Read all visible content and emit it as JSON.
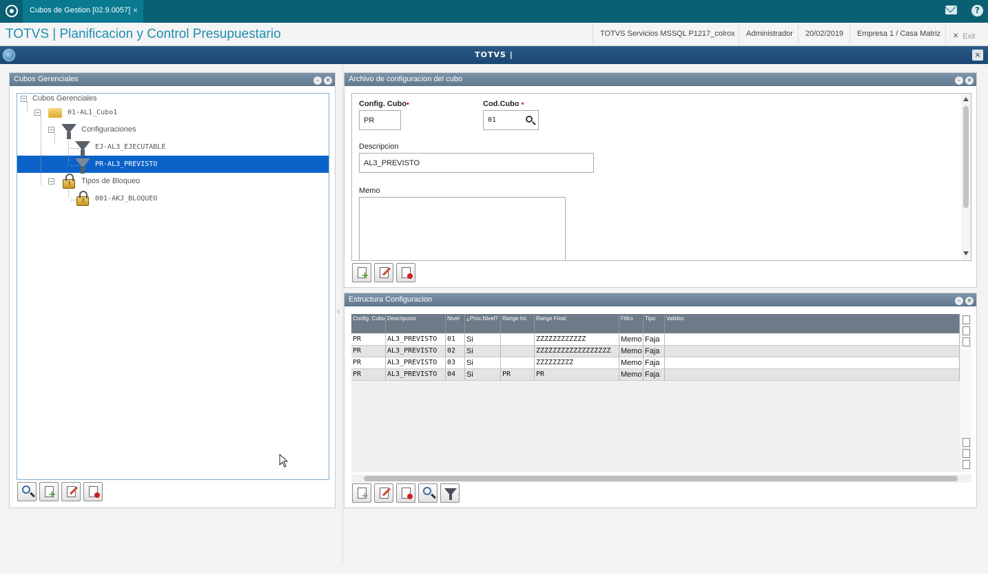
{
  "topbar": {
    "tab_label": "Cubos de Gestion [02.9.0057]",
    "tab_close": "×",
    "help": "?"
  },
  "titlebar": {
    "app_title": "TOTVS | Planificacion y Control Presupuestario",
    "server": "TOTVS Servicios MSSQL P1217_colrox",
    "user": "Administrador",
    "date": "20/02/2019",
    "company": "Empresa 1 / Casa Matriz",
    "exit": "Exit",
    "exit_icon": "×"
  },
  "window": {
    "title": "TOTVS |",
    "close": "×"
  },
  "left_panel": {
    "title": "Cubos Gerenciales",
    "tree": {
      "root": "Cubos Gerenciales",
      "cube": "01-AL1_Cubo1",
      "configs": "Configuraciones",
      "config_1": "EJ-AL3_EJECUTABLE",
      "config_2": "PR-AL3_PREVISTO",
      "locks": "Tipos de Bloqueo",
      "lock_1": "001-AKJ_BLOQUEO"
    }
  },
  "config_panel": {
    "title": "Archivo de configuracion del cubo",
    "config_cubo_label": "Config. Cubo",
    "config_cubo_value": "PR",
    "cod_cubo_label": "Cod.Cubo",
    "cod_cubo_value": "01",
    "required_mark": "•",
    "descripcion_label": "Descripcion",
    "descripcion_value": "AL3_PREVISTO",
    "memo_label": "Memo",
    "memo_value": ""
  },
  "structure_panel": {
    "title": "Estructura Configuracion",
    "columns": [
      "Config. Cubo",
      "Descripcion",
      "Nivel",
      "¿Proc.Nivel?",
      "Range Ini.",
      "Range Final",
      "Filtro",
      "Tipo",
      "Validez"
    ],
    "rows": [
      [
        "PR",
        "AL3_PREVISTO",
        "01",
        "Si",
        "",
        "ZZZZZZZZZZZZ",
        "Memo",
        "Faja",
        ""
      ],
      [
        "PR",
        "AL3_PREVISTO",
        "02",
        "Si",
        "",
        "ZZZZZZZZZZZZZZZZZZ",
        "Memo",
        "Faja",
        ""
      ],
      [
        "PR",
        "AL3_PREVISTO",
        "03",
        "Si",
        "",
        "ZZZZZZZZZ",
        "Memo",
        "Faja",
        ""
      ],
      [
        "PR",
        "AL3_PREVISTO",
        "04",
        "Si",
        "PR",
        "PR",
        "Memo",
        "Faja",
        ""
      ]
    ]
  },
  "panel_buttons": {
    "minimize": "–",
    "close": "×"
  }
}
